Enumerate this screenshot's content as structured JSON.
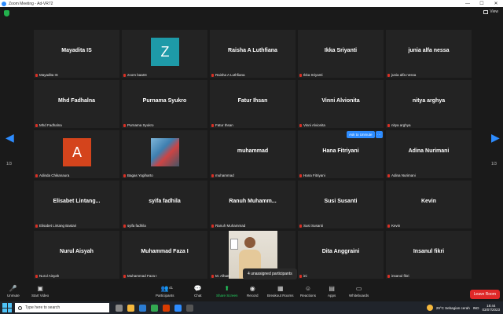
{
  "window": {
    "title": "Zoom Meeting - Ad-VR72",
    "minimize": "—",
    "maximize": "☐",
    "close": "✕"
  },
  "topbar": {
    "view_label": "View"
  },
  "pager": {
    "left_page": "1/3",
    "right_page": "1/3"
  },
  "tiles": [
    {
      "name": "Mayadita IS",
      "label": "Mayadita IS"
    },
    {
      "name": "",
      "label": "zoom baa04",
      "avatar_letter": "Z",
      "avatar_color": "#1e9aa8"
    },
    {
      "name": "Raisha A Luthfiana",
      "label": "Raisha A Luthfiana"
    },
    {
      "name": "Ikka Sriyanti",
      "label": "Ikka Sriyanti"
    },
    {
      "name": "junia alfa nessa",
      "label": "junia alfa nessa"
    },
    {
      "name": "Mhd Fadhalna",
      "label": "Mhd Fadhalna"
    },
    {
      "name": "Purnama Syukro",
      "label": "Purnama Syukro"
    },
    {
      "name": "Fatur Ihsan",
      "label": "Fatur Ihsan"
    },
    {
      "name": "Vinni Alvionita",
      "label": "Vinni Alvionita"
    },
    {
      "name": "nitya arghya",
      "label": "nitya arghya"
    },
    {
      "name": "",
      "label": "Adinda Chikanaura",
      "avatar_letter": "A",
      "avatar_color": "#d4441c"
    },
    {
      "name": "",
      "label": "Bagas Yogiharto",
      "photo": true
    },
    {
      "name": "muhammad",
      "label": "muhammad"
    },
    {
      "name": "Hana Fitriyani",
      "label": "Hana Fitriyani"
    },
    {
      "name": "Adina Nurimani",
      "label": "Adina Nurimani"
    },
    {
      "name": "Elisabet  Lintang...",
      "label": "Elisabet Lintang Bastari"
    },
    {
      "name": "syifa fadhila",
      "label": "syifa fadhila"
    },
    {
      "name": "Ranuh  Muhamm...",
      "label": "Ranuh Muhammad"
    },
    {
      "name": "Susi Susanti",
      "label": "Susi Susanti"
    },
    {
      "name": "Kevin",
      "label": "Kevin"
    },
    {
      "name": "Nurul Aisyah",
      "label": "Nurul Aisyah"
    },
    {
      "name": "Muhammad Faza I",
      "label": "Muhammad Faza I"
    },
    {
      "name": "",
      "label": "M. Alham",
      "camera": true
    },
    {
      "name": "Dita Anggraini",
      "label": "ini"
    },
    {
      "name": "Insanul fikri",
      "label": "insanul fikri"
    }
  ],
  "admit": {
    "label": "Ask to Unmute",
    "more": "···"
  },
  "popup": {
    "unassigned": "4 unassigned participants"
  },
  "toolbar": {
    "unmute": "Unmute",
    "start_video": "Start Video",
    "participants": "Participants",
    "participants_count": "41",
    "chat": "Chat",
    "share_screen": "Share Screen",
    "record": "Record",
    "breakout_rooms": "Breakout Rooms",
    "reactions": "Reactions",
    "apps": "Apps",
    "whiteboards": "Whiteboards",
    "leave": "Leave Room"
  },
  "taskbar": {
    "search_placeholder": "Type here to search",
    "weather": "29°C  Sebagian cerah",
    "time": "18:44",
    "date": "03/07/2023",
    "lang": "IND"
  }
}
